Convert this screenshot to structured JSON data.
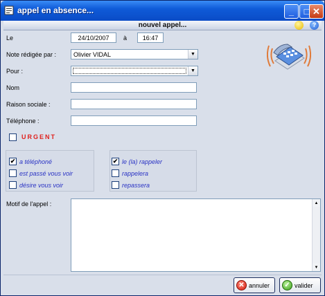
{
  "window": {
    "title": "appel en absence..."
  },
  "header": {
    "title": "nouvel appel..."
  },
  "form": {
    "le_label": "Le",
    "date_value": "24/10/2007",
    "a_label": "à",
    "time_value": "16:47",
    "note_label": "Note rédigée par :",
    "note_value": "Olivier VIDAL",
    "pour_label": "Pour :",
    "pour_value": "",
    "nom_label": "Nom",
    "nom_value": "",
    "raison_label": "Raison sociale :",
    "raison_value": "",
    "telephone_label": "Téléphone :",
    "telephone_value": "",
    "urgent_label": "URGENT",
    "urgent_checked": false,
    "motif_label": "Motif de l'appel :",
    "motif_value": ""
  },
  "left_options": [
    {
      "label": "a téléphoné",
      "checked": true
    },
    {
      "label": "est passé vous voir",
      "checked": false
    },
    {
      "label": "désire vous voir",
      "checked": false
    }
  ],
  "right_options": [
    {
      "label": "le (la) rappeler",
      "checked": true
    },
    {
      "label": "rappelera",
      "checked": false
    },
    {
      "label": "repassera",
      "checked": false
    }
  ],
  "buttons": {
    "cancel_label": "annuler",
    "validate_label": "valider"
  },
  "icons": {
    "title": "form-icon",
    "minimize": "minimize-icon",
    "maximize": "maximize-icon",
    "close": "close-icon",
    "sub_left": "yellow-circle-icon",
    "help": "help-icon",
    "phone": "phone-icon",
    "cancel": "cancel-icon",
    "validate": "check-icon"
  },
  "colors": {
    "titlebar": "#0f5bd8",
    "urgent": "#e0201c",
    "option_text": "#2a33c4",
    "background": "#d9dfea"
  }
}
